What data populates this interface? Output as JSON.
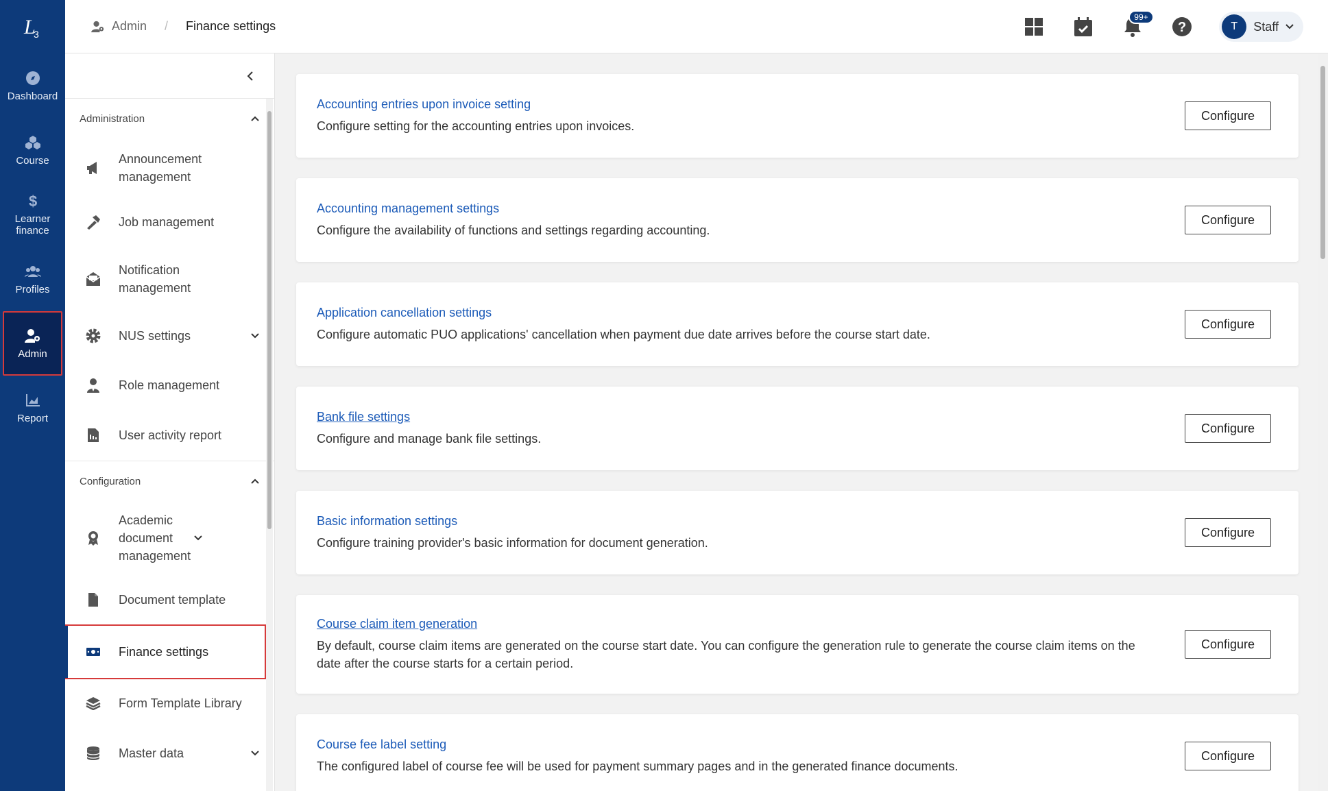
{
  "rail": {
    "items": [
      {
        "label": "Dashboard",
        "icon": "compass-icon"
      },
      {
        "label": "Course",
        "icon": "cubes-icon"
      },
      {
        "label": "Learner finance",
        "icon": "dollar-icon"
      },
      {
        "label": "Profiles",
        "icon": "users-icon"
      },
      {
        "label": "Admin",
        "icon": "user-cog-icon",
        "active": true
      },
      {
        "label": "Report",
        "icon": "chart-icon"
      }
    ]
  },
  "breadcrumb": {
    "parent": "Admin",
    "sep": "/",
    "current": "Finance settings"
  },
  "header": {
    "notifications_badge": "99+",
    "avatar_initial": "T",
    "user_label": "Staff"
  },
  "subnav": {
    "administration_header": "Administration",
    "administration_items": [
      "Announcement management",
      "Job management",
      "Notification management",
      "NUS settings",
      "Role management",
      "User activity report"
    ],
    "configuration_header": "Configuration",
    "configuration_items": [
      "Academic document management",
      "Document template",
      "Finance settings",
      "Form Template Library",
      "Master data"
    ]
  },
  "cards": [
    {
      "title": "Accounting entries upon invoice setting",
      "desc": "Configure setting for the accounting entries upon invoices.",
      "button": "Configure"
    },
    {
      "title": "Accounting management settings",
      "desc": "Configure the availability of functions and settings regarding accounting.",
      "button": "Configure"
    },
    {
      "title": "Application cancellation settings",
      "desc": "Configure automatic PUO applications' cancellation when payment due date arrives before the course start date.",
      "button": "Configure"
    },
    {
      "title": "Bank file settings",
      "desc": "Configure and manage bank file settings.",
      "button": "Configure"
    },
    {
      "title": "Basic information settings",
      "desc": "Configure training provider's basic information for document generation.",
      "button": "Configure"
    },
    {
      "title": "Course claim item generation",
      "desc": "By default, course claim items are generated on the course start date. You can configure the generation rule to generate the course claim items on the date after the course starts for a certain period.",
      "button": "Configure"
    },
    {
      "title": "Course fee label setting",
      "desc": "The configured label of course fee will be used for payment summary pages and in the generated finance documents.",
      "button": "Configure"
    }
  ],
  "colors": {
    "rail": "#0d3a7a",
    "link": "#1c5bb8",
    "highlight": "#d63a3a"
  }
}
